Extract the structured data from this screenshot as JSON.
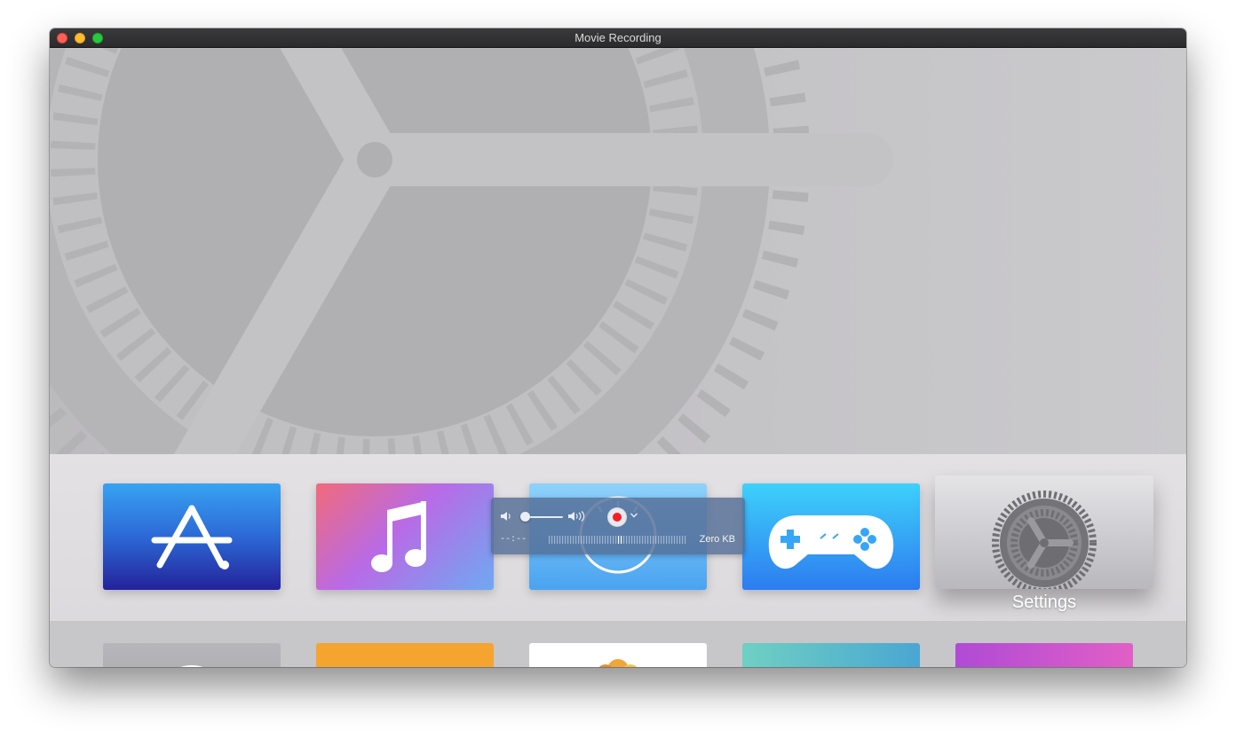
{
  "window": {
    "title": "Movie Recording",
    "traffic_lights": [
      "close",
      "minimize",
      "zoom"
    ]
  },
  "tv_home": {
    "apps_row1": [
      {
        "name": "App Store",
        "icon": "app-store-icon"
      },
      {
        "name": "Music",
        "icon": "music-note-icon"
      },
      {
        "name": "Speed test",
        "icon": "speedometer-icon"
      },
      {
        "name": "Games",
        "icon": "gamepad-icon"
      },
      {
        "name": "Settings",
        "icon": "gear-icon",
        "focused": true,
        "label": "Settings"
      }
    ],
    "colors": {
      "background": "#c6c5c8",
      "shelf": "#e0dee1"
    }
  },
  "recording_hud": {
    "elapsed_time": "--:--",
    "file_size": "Zero KB",
    "volume_level": 0.0,
    "record_color": "#fb1c24"
  }
}
